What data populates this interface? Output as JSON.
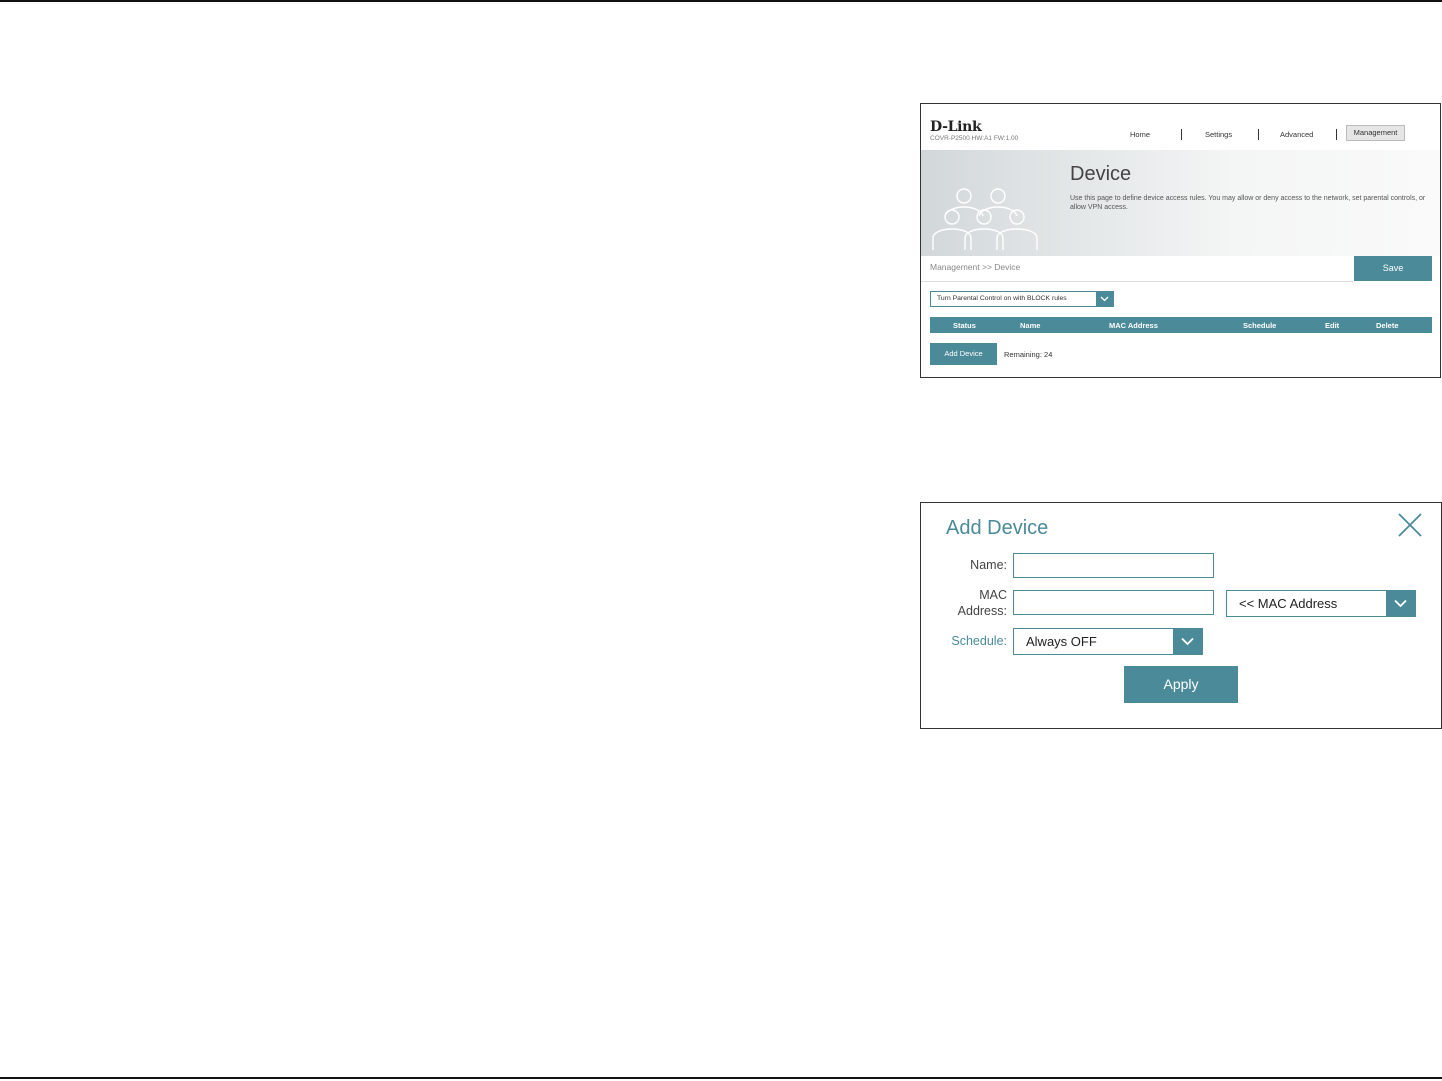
{
  "device_page": {
    "logo": "D-Link",
    "model_info": "COVR-P2500   HW:A1   FW:1.00",
    "nav": {
      "home": "Home",
      "settings": "Settings",
      "advanced": "Advanced",
      "management": "Management"
    },
    "title": "Device",
    "description": "Use this page to define device access rules. You may allow or deny access to the network, set parental controls, or allow VPN access.",
    "breadcrumb": "Management >> Device",
    "save_label": "Save",
    "parental_control_selected": "Turn Parental Control on with BLOCK rules",
    "table_headers": [
      "Status",
      "Name",
      "MAC Address",
      "Schedule",
      "Edit",
      "Delete"
    ],
    "add_device_label": "Add Device",
    "remaining": "Remaining: 24"
  },
  "add_device_dialog": {
    "title": "Add Device",
    "name_label": "Name:",
    "name_value": "",
    "mac_label_line1": "MAC",
    "mac_label_line2": "Address:",
    "mac_value": "",
    "mac_select": "<< MAC Address",
    "schedule_label": "Schedule:",
    "schedule_value": "Always OFF",
    "apply_label": "Apply"
  },
  "colors": {
    "accent": "#4b8a99",
    "border": "#333333"
  }
}
